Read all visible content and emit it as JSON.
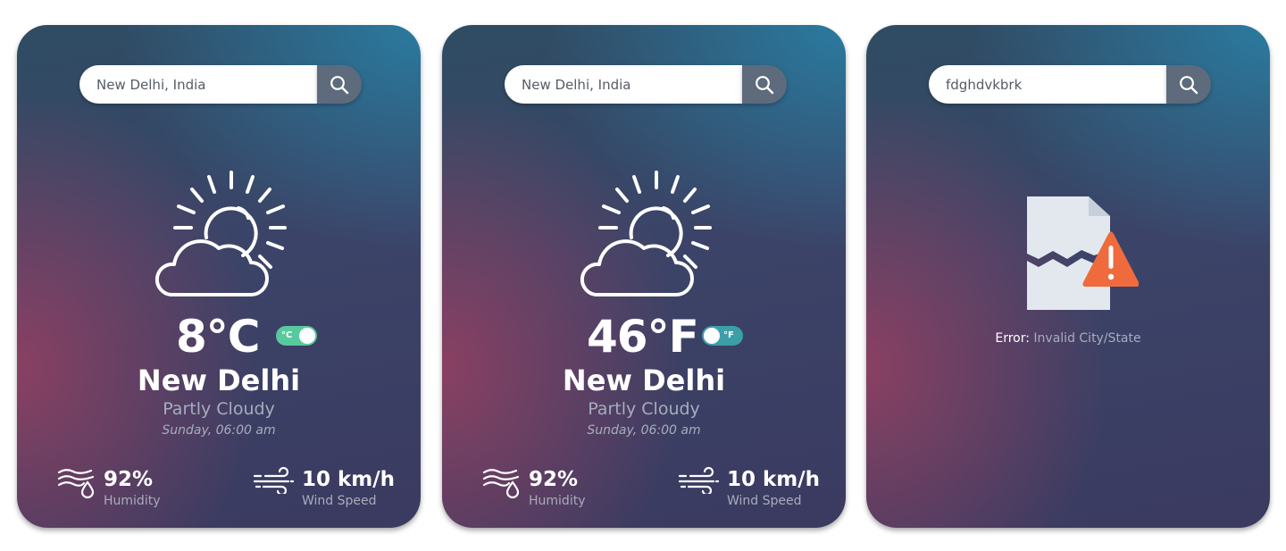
{
  "colors": {
    "card_gradient_top": "#2a7da3",
    "card_gradient_mid": "#3b4468",
    "card_gradient_accent": "#8e4062",
    "search_button": "#5d6b7c",
    "toggle_celsius": "#58c99c",
    "toggle_fahrenheit": "#3b9fa8",
    "error_triangle": "#ef6b3d",
    "error_document": "#e3e8ef",
    "secondary_text": "#a6adbb"
  },
  "cards": [
    {
      "search": {
        "value": "New Delhi, India",
        "button_icon": "search-icon"
      },
      "weather_icon": "partly-cloudy-icon",
      "temperature": "8°C",
      "unit_toggle": {
        "label": "°C",
        "active_unit": "celsius"
      },
      "city": "New Delhi",
      "condition": "Partly Cloudy",
      "datetime": "Sunday, 06:00 am",
      "humidity": {
        "value": "92%",
        "label": "Humidity",
        "icon": "humidity-icon"
      },
      "wind": {
        "value": "10 km/h",
        "label": "Wind Speed",
        "icon": "wind-icon"
      }
    },
    {
      "search": {
        "value": "New Delhi, India",
        "button_icon": "search-icon"
      },
      "weather_icon": "partly-cloudy-icon",
      "temperature": "46°F",
      "unit_toggle": {
        "label": "°F",
        "active_unit": "fahrenheit"
      },
      "city": "New Delhi",
      "condition": "Partly Cloudy",
      "datetime": "Sunday, 06:00 am",
      "humidity": {
        "value": "92%",
        "label": "Humidity",
        "icon": "humidity-icon"
      },
      "wind": {
        "value": "10 km/h",
        "label": "Wind Speed",
        "icon": "wind-icon"
      }
    },
    {
      "search": {
        "value": "fdghdvkbrk",
        "button_icon": "search-icon"
      },
      "error_icon": "broken-file-warning-icon",
      "error": {
        "label": "Error:",
        "message": "Invalid City/State"
      }
    }
  ]
}
